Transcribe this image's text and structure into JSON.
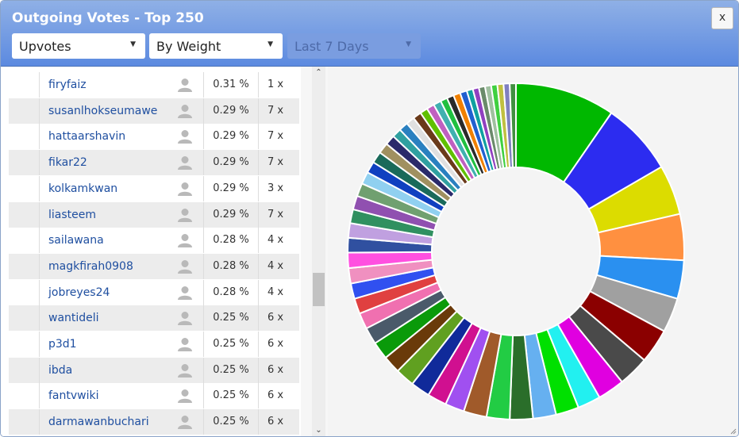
{
  "window": {
    "title": "Outgoing Votes - Top 250",
    "close_label": "x"
  },
  "filters": [
    {
      "label": "Upvotes"
    },
    {
      "label": "By Weight"
    },
    {
      "label": "Last 7 Days",
      "disabled": true
    }
  ],
  "rows": [
    {
      "name": "firyfaiz",
      "pct": "0.31 %",
      "count": "1 x"
    },
    {
      "name": "susanlhokseumawe",
      "pct": "0.29 %",
      "count": "7 x"
    },
    {
      "name": "hattaarshavin",
      "pct": "0.29 %",
      "count": "7 x"
    },
    {
      "name": "fikar22",
      "pct": "0.29 %",
      "count": "7 x"
    },
    {
      "name": "kolkamkwan",
      "pct": "0.29 %",
      "count": "3 x"
    },
    {
      "name": "liasteem",
      "pct": "0.29 %",
      "count": "7 x"
    },
    {
      "name": "sailawana",
      "pct": "0.28 %",
      "count": "4 x"
    },
    {
      "name": "magkfirah0908",
      "pct": "0.28 %",
      "count": "4 x"
    },
    {
      "name": "jobreyes24",
      "pct": "0.28 %",
      "count": "4 x"
    },
    {
      "name": "wantideli",
      "pct": "0.25 %",
      "count": "6 x"
    },
    {
      "name": "p3d1",
      "pct": "0.25 %",
      "count": "6 x"
    },
    {
      "name": "ibda",
      "pct": "0.25 %",
      "count": "6 x"
    },
    {
      "name": "fantvwiki",
      "pct": "0.25 %",
      "count": "6 x"
    },
    {
      "name": "darmawanbuchari",
      "pct": "0.25 %",
      "count": "6 x"
    }
  ],
  "chart_data": {
    "type": "pie",
    "donut": true,
    "values": [
      13,
      9.5,
      6.5,
      6,
      5,
      4.5,
      4.5,
      4,
      3.5,
      3,
      3,
      3,
      3,
      3,
      3,
      2.5,
      2.5,
      2.5,
      2.5,
      2.3,
      2.3,
      2.2,
      2.1,
      2,
      2,
      2,
      2,
      1.9,
      1.9,
      1.8,
      1.8,
      1.7,
      1.6,
      1.5,
      1.5,
      1.4,
      1.3,
      1.2,
      1.2,
      1.1,
      1.1,
      1,
      1,
      1,
      0.9,
      0.9,
      0.9,
      0.9,
      0.8,
      0.8,
      0.8,
      0.8,
      0.8,
      0.8,
      0.8,
      0.8
    ],
    "colors": [
      "#00b800",
      "#2c2cf0",
      "#dcdc00",
      "#ff9040",
      "#2a90f0",
      "#a0a0a0",
      "#8b0000",
      "#4a4a4a",
      "#e000e0",
      "#22f0f0",
      "#00e000",
      "#66b0f0",
      "#2a6e2a",
      "#22cc44",
      "#a05a2a",
      "#a050f0",
      "#d01090",
      "#102a9a",
      "#60a020",
      "#6a3a0a",
      "#0a9a0a",
      "#4a5a6a",
      "#f070b0",
      "#e04040",
      "#3050f0",
      "#f090c0",
      "#ff50e0",
      "#3050a0",
      "#c0a0e0",
      "#309060",
      "#9050b0",
      "#70a070",
      "#90d0f0",
      "#1040c0",
      "#1a6a5a",
      "#a09060",
      "#2a2a6a",
      "#30a0a0",
      "#2a80c0",
      "#e0e0e0",
      "#6a3a1a",
      "#60c000",
      "#c060c0",
      "#40b0b0",
      "#20c040",
      "#2a2a2a",
      "#f08000",
      "#2060d0",
      "#10a0a0",
      "#9040c0",
      "#6a8a6a",
      "#a0c0a0",
      "#40d040",
      "#c0c040",
      "#8080c0",
      "#409040"
    ]
  }
}
